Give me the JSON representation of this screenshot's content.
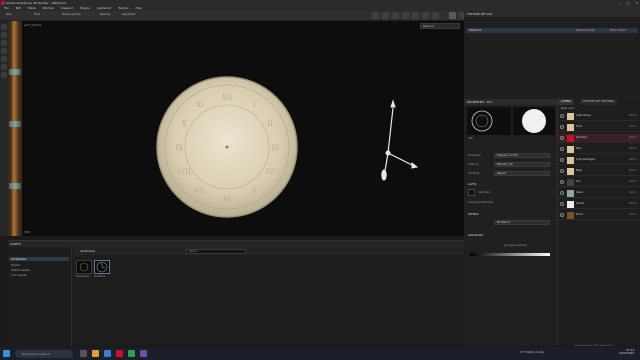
{
  "app": {
    "title": "Adobe Substance 3D Painter - WallClock",
    "window_buttons": [
      "—",
      "□",
      "✕"
    ]
  },
  "menu": [
    "File",
    "Edit",
    "Mode",
    "Window",
    "Viewport",
    "Plugins",
    "JavaScript",
    "Texture",
    "Help"
  ],
  "toolbar": {
    "items": [
      "Size",
      "Flow",
      "Stroke opacity",
      "Spacing",
      "Alignment"
    ]
  },
  "viewport": {
    "file_label": "w15_UPL.txt",
    "display_mode": "Material",
    "corner_label": "HDRI"
  },
  "assets": {
    "title": "ASSETS",
    "search_placeholder": "Search",
    "breadcrumb": "All libraries",
    "tree": [
      "All libraries",
      "Project",
      "Starter assets",
      "Your assets"
    ],
    "thumbs": [
      "Procedurals",
      "Clockface"
    ]
  },
  "texture_set": {
    "title": "TEXTURE SET LIST",
    "selected": "WallClock",
    "shader": "Default shader",
    "mode": "Main shader"
  },
  "properties": {
    "title": "PROPERTIES - FILL",
    "tab_fill": "Fill",
    "section_material": "MATERIAL",
    "rows": [
      {
        "label": "Projection",
        "value": "Triplanar / UV fill"
      },
      {
        "label": "Filtering",
        "value": "Bilinear | HQ"
      },
      {
        "label": "UV Wrap",
        "value": "Repeat"
      }
    ],
    "alpha_title": "ALPHA",
    "alpha_name": "Clockface",
    "advanced": "Advanced Blending",
    "stencil_title": "STENCIL",
    "stencil_value": "No Stencil",
    "grayscale_title": "GRAYSCALE",
    "grayscale_name": "grunge-scratches"
  },
  "layers": {
    "tabs": [
      "LAYERS",
      "TEXTURE SET SETTINGS"
    ],
    "blend_label": "Base color",
    "rows": [
      {
        "name": "Light Decay",
        "mode": "Norm 1"
      },
      {
        "name": "Dust",
        "mode": "Norm 1"
      },
      {
        "name": "Numbers",
        "mode": "Norm 1"
      },
      {
        "name": "Rust",
        "mode": "Norm 1"
      },
      {
        "name": "Light Damaged",
        "mode": "Norm 1"
      },
      {
        "name": "Base",
        "mode": "Norm 1"
      },
      {
        "name": "Iron",
        "mode": "Norm 1"
      },
      {
        "name": "Glass",
        "mode": "Norm 1"
      },
      {
        "name": "Hands",
        "mode": "Norm 1"
      },
      {
        "name": "Wood",
        "mode": "Norm 1"
      }
    ]
  },
  "statusbar": {
    "text": "Cache Disk Usage: 67% | Version: 8.3.0"
  },
  "taskbar": {
    "search": "Type here to search",
    "weather": "17°C  Partly cloudy",
    "time": "07:14",
    "date": "21/07/2023"
  },
  "colors": {
    "accent": "#c8102e",
    "selection": "#2d3744"
  }
}
